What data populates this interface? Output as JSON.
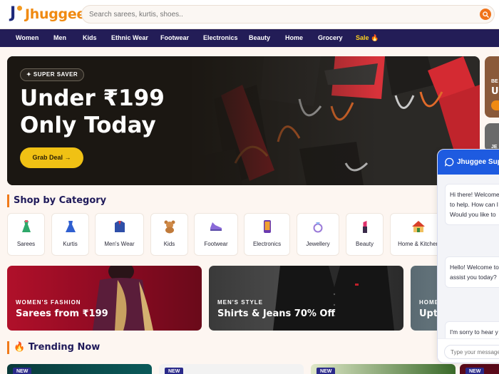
{
  "header": {
    "logo_text": "Jhuggee",
    "search_placeholder": "Search sarees, kurtis, shoes..",
    "search_icon": "search-icon"
  },
  "nav": {
    "items": [
      {
        "label": "Women"
      },
      {
        "label": "Men"
      },
      {
        "label": "Kids"
      },
      {
        "label": "Ethnic Wear"
      },
      {
        "label": "Footwear"
      },
      {
        "label": "Electronics"
      },
      {
        "label": "Beauty"
      },
      {
        "label": "Home"
      },
      {
        "label": "Grocery"
      },
      {
        "label": "Sale 🔥"
      }
    ]
  },
  "hero": {
    "badge": "✦ SUPER SAVER",
    "line1": "Under ₹199",
    "line2": "Only Today",
    "cta": "Grab Deal →"
  },
  "side_cards": [
    {
      "kicker": "BE",
      "title": "U"
    },
    {
      "kicker": "JE",
      "title": ""
    }
  ],
  "categories": {
    "title": "Shop by Category",
    "items": [
      {
        "label": "Sarees",
        "icon": "dress-icon"
      },
      {
        "label": "Kurtis",
        "icon": "dress-icon"
      },
      {
        "label": "Men's Wear",
        "icon": "shirt-icon"
      },
      {
        "label": "Kids",
        "icon": "teddy-bear-icon"
      },
      {
        "label": "Footwear",
        "icon": "shoe-icon"
      },
      {
        "label": "Electronics",
        "icon": "phone-icon"
      },
      {
        "label": "Jewellery",
        "icon": "ring-icon"
      },
      {
        "label": "Beauty",
        "icon": "lipstick-icon"
      },
      {
        "label": "Home & Kitchen",
        "icon": "house-icon"
      }
    ]
  },
  "promos": [
    {
      "kicker": "WOMEN'S FASHION",
      "title": "Sarees from ₹199"
    },
    {
      "kicker": "MEN'S STYLE",
      "title": "Shirts & Jeans 70% Off"
    },
    {
      "kicker": "HOME",
      "title": "Upt"
    }
  ],
  "trending": {
    "title": "🔥 Trending Now",
    "badges": [
      "NEW",
      "NEW",
      "NEW",
      "NEW"
    ]
  },
  "chat": {
    "title": "Jhuggee Support",
    "messages": [
      {
        "lines": [
          "Hi there! Welcome",
          "to help. How can I",
          "Would you like to"
        ]
      },
      {
        "lines": [
          "Hello! Welcome to",
          "assist you today?"
        ]
      },
      {
        "lines": [
          "I'm sorry to hear y"
        ]
      }
    ],
    "input_placeholder": "Type your message..."
  },
  "colors": {
    "brand_orange": "#f08a12",
    "nav_bg": "#231d57",
    "cta_yellow": "#f0c114",
    "chat_blue": "#1e5be0",
    "accent_bar": "#f07a1a"
  }
}
